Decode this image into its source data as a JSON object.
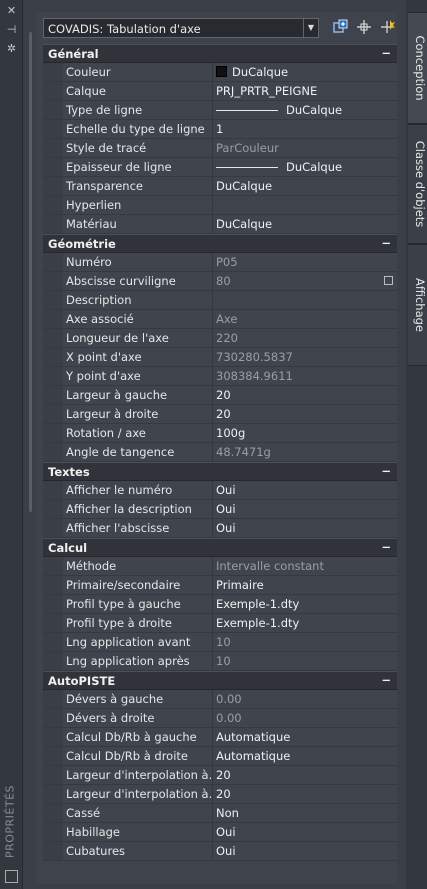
{
  "left_strip": {
    "close": "✕",
    "pin": "⊣",
    "settings": "✲",
    "vertical_label": "PROPRIÉTÉS"
  },
  "header": {
    "selector_value": "COVADIS: Tabulation d'axe"
  },
  "tabs": [
    {
      "label": "Conception"
    },
    {
      "label": "Classe d'objets"
    },
    {
      "label": "Affichage"
    }
  ],
  "sections": [
    {
      "title": "Général",
      "rows": [
        {
          "label": "Couleur",
          "value": "DuCalque",
          "swatch": "#111111"
        },
        {
          "label": "Calque",
          "value": "PRJ_PRTR_PEIGNE"
        },
        {
          "label": "Type de ligne",
          "value": "DuCalque",
          "line": true
        },
        {
          "label": "Echelle du type de ligne",
          "value": "1"
        },
        {
          "label": "Style de tracé",
          "value": "ParCouleur",
          "readonly": true
        },
        {
          "label": "Epaisseur de ligne",
          "value": "DuCalque",
          "line": true
        },
        {
          "label": "Transparence",
          "value": "DuCalque"
        },
        {
          "label": "Hyperlien",
          "value": ""
        },
        {
          "label": "Matériau",
          "value": "DuCalque"
        }
      ]
    },
    {
      "title": "Géométrie",
      "rows": [
        {
          "label": "Numéro",
          "value": "P05",
          "readonly": true
        },
        {
          "label": "Abscisse curviligne",
          "value": "80",
          "readonly": true,
          "calc": true
        },
        {
          "label": "Description",
          "value": ""
        },
        {
          "label": "Axe associé",
          "value": "Axe",
          "readonly": true
        },
        {
          "label": "Longueur de l'axe",
          "value": "220",
          "readonly": true
        },
        {
          "label": "X point d'axe",
          "value": "730280.5837",
          "readonly": true
        },
        {
          "label": "Y point d'axe",
          "value": "308384.9611",
          "readonly": true
        },
        {
          "label": "Largeur à gauche",
          "value": "20"
        },
        {
          "label": "Largeur à droite",
          "value": "20"
        },
        {
          "label": "Rotation / axe",
          "value": "100g"
        },
        {
          "label": "Angle de tangence",
          "value": "48.7471g",
          "readonly": true
        }
      ]
    },
    {
      "title": "Textes",
      "rows": [
        {
          "label": "Afficher le numéro",
          "value": "Oui"
        },
        {
          "label": "Afficher la description",
          "value": "Oui"
        },
        {
          "label": "Afficher l'abscisse",
          "value": "Oui"
        }
      ]
    },
    {
      "title": "Calcul",
      "rows": [
        {
          "label": "Méthode",
          "value": "Intervalle constant",
          "readonly": true
        },
        {
          "label": "Primaire/secondaire",
          "value": "Primaire"
        },
        {
          "label": "Profil type à gauche",
          "value": "Exemple-1.dty"
        },
        {
          "label": "Profil type à droite",
          "value": "Exemple-1.dty"
        },
        {
          "label": "Lng application avant",
          "value": "10",
          "readonly": true
        },
        {
          "label": "Lng application après",
          "value": "10",
          "readonly": true
        }
      ]
    },
    {
      "title": "AutoPISTE",
      "rows": [
        {
          "label": "Dévers à gauche",
          "value": "0.00",
          "readonly": true
        },
        {
          "label": "Dévers à droite",
          "value": "0.00",
          "readonly": true
        },
        {
          "label": "Calcul Db/Rb à gauche",
          "value": "Automatique"
        },
        {
          "label": "Calcul Db/Rb à droite",
          "value": "Automatique"
        },
        {
          "label": "Largeur  d'interpolation à...",
          "value": "20"
        },
        {
          "label": "Largeur  d'interpolation à...",
          "value": "20"
        },
        {
          "label": "Cassé",
          "value": "Non"
        },
        {
          "label": "Habillage",
          "value": "Oui"
        },
        {
          "label": "Cubatures",
          "value": "Oui"
        }
      ]
    }
  ]
}
